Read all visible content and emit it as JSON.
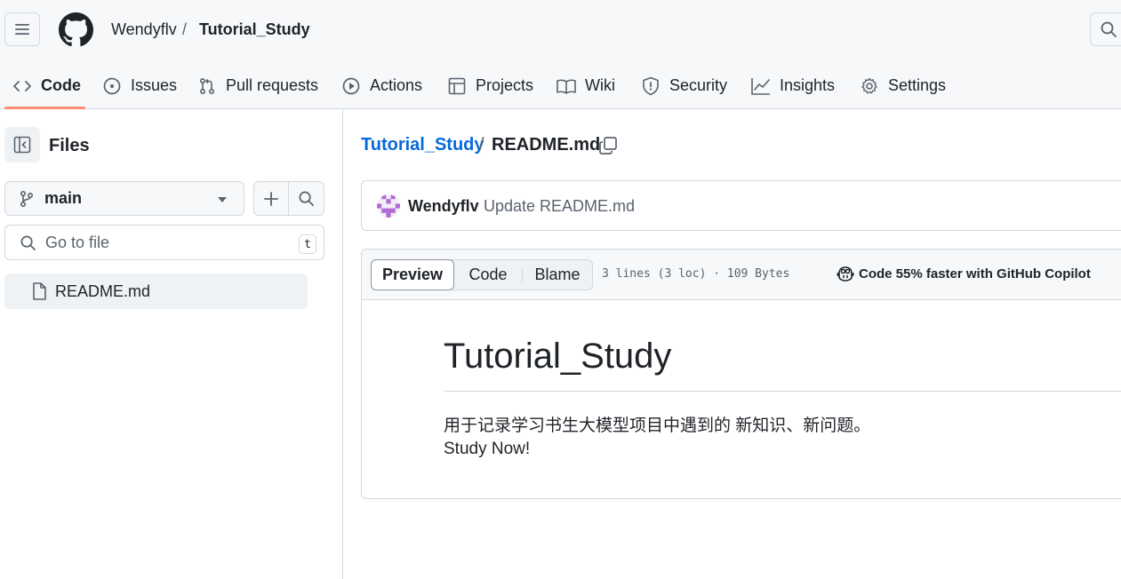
{
  "header": {
    "owner": "Wendyflv",
    "separator": "/",
    "repo": "Tutorial_Study"
  },
  "tabs": [
    {
      "label": "Code",
      "icon": "code-icon",
      "active": true
    },
    {
      "label": "Issues",
      "icon": "issue-opened-icon"
    },
    {
      "label": "Pull requests",
      "icon": "git-pull-request-icon"
    },
    {
      "label": "Actions",
      "icon": "play-icon"
    },
    {
      "label": "Projects",
      "icon": "table-icon"
    },
    {
      "label": "Wiki",
      "icon": "book-icon"
    },
    {
      "label": "Security",
      "icon": "shield-icon"
    },
    {
      "label": "Insights",
      "icon": "graph-icon"
    },
    {
      "label": "Settings",
      "icon": "gear-icon"
    }
  ],
  "sidebar": {
    "title": "Files",
    "branch": "main",
    "goto_placeholder": "Go to file",
    "goto_shortcut": "t",
    "files": [
      {
        "name": "README.md",
        "selected": true
      }
    ]
  },
  "main": {
    "path_repo": "Tutorial_Study",
    "path_sep": "/",
    "path_file": "README.md",
    "commit": {
      "author": "Wendyflv",
      "message": "Update README.md"
    },
    "view_tabs": {
      "preview": "Preview",
      "code": "Code",
      "blame": "Blame",
      "selected": "Preview"
    },
    "file_stats": "3 lines (3 loc) · 109 Bytes",
    "copilot_text": "Code 55% faster with GitHub Copilot",
    "readme": {
      "title": "Tutorial_Study",
      "line1": "用于记录学习书生大模型项目中遇到的 新知识、新问题。",
      "line2": "Study Now!"
    }
  },
  "colors": {
    "accent_underline": "#fd8c73",
    "link": "#0969da",
    "text": "#1f2328",
    "muted": "#59636e",
    "border": "#d1d9e0"
  }
}
